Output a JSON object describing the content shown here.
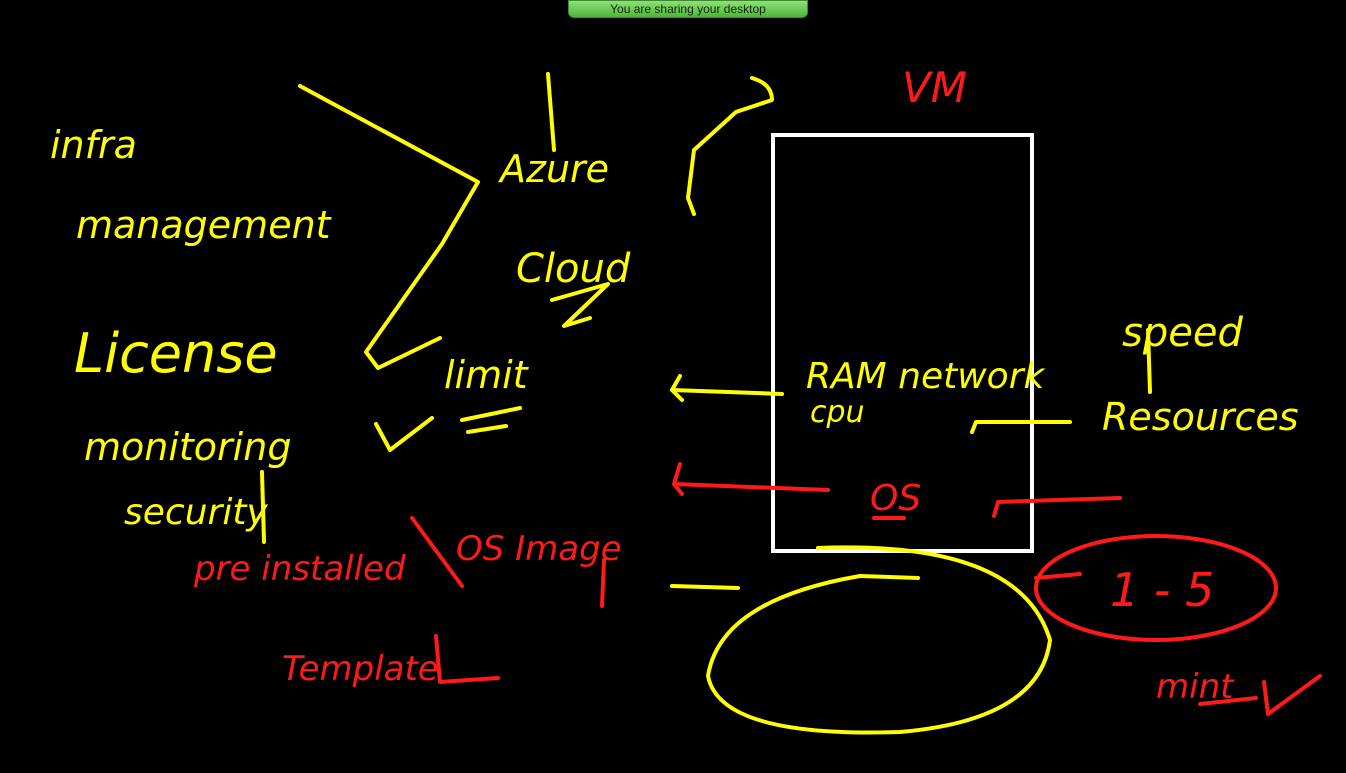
{
  "banner": {
    "text": "You are sharing your desktop"
  },
  "board": {
    "title": "VM",
    "left_list": [
      "infra",
      "management",
      "License",
      "monitoring",
      "security"
    ],
    "middle": [
      "Azure",
      "Cloud",
      "limit"
    ],
    "vm_box": {
      "resources_line": "RAM network",
      "cpu": "cpu",
      "os": "OS"
    },
    "right": {
      "speed": "speed",
      "resources": "Resources",
      "range": "1 - 5",
      "mint": "mint"
    },
    "bottom": {
      "prebaked": "pre installed",
      "os_image": "OS Image",
      "template": "Template"
    }
  },
  "colors": {
    "yellow": "#ffff00",
    "red": "#ff1a1a",
    "white": "#ffffff",
    "background": "#000000",
    "banner_green": "#5cc043"
  }
}
